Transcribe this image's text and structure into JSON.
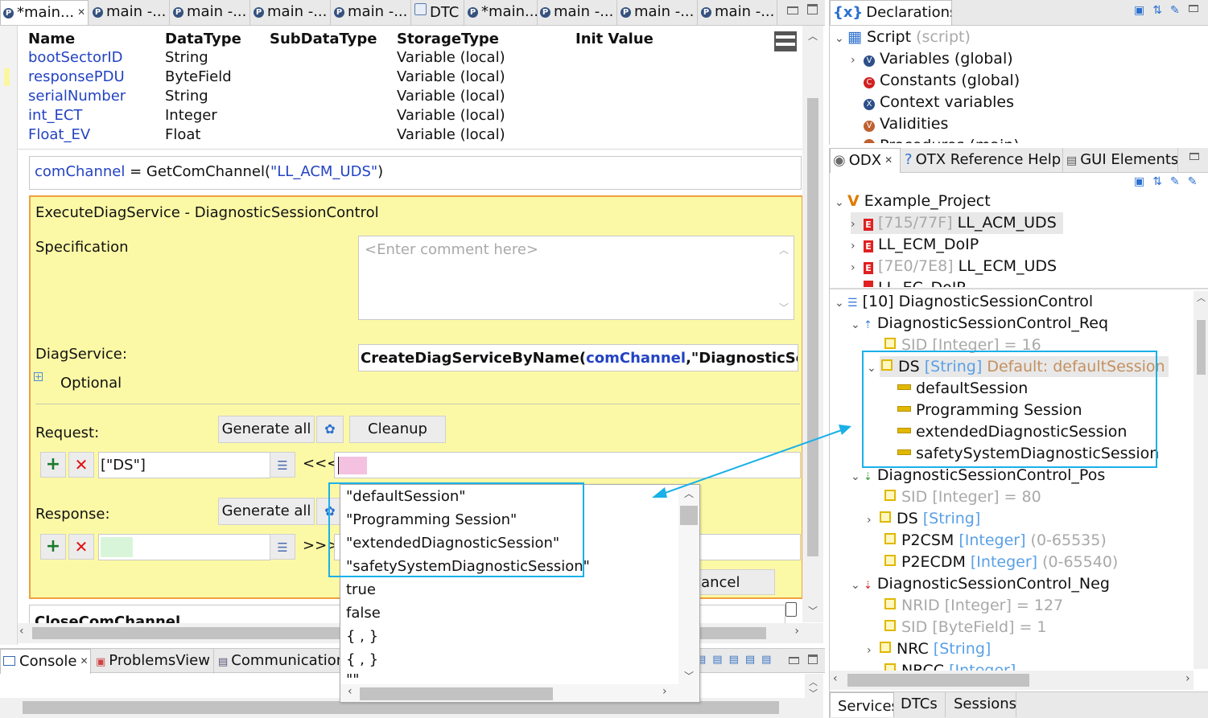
{
  "editor_tabs": [
    {
      "label": "*main...",
      "active": true
    },
    {
      "label": "main -..."
    },
    {
      "label": "main -..."
    },
    {
      "label": "main -..."
    },
    {
      "label": "main -..."
    },
    {
      "label": "DTC"
    },
    {
      "label": "*main..."
    },
    {
      "label": "main -..."
    },
    {
      "label": "main -..."
    },
    {
      "label": "main -..."
    }
  ],
  "variables": {
    "headers": [
      "Name",
      "DataType",
      "SubDataType",
      "StorageType",
      "Init Value"
    ],
    "rows": [
      {
        "name": "bootSectorID",
        "type": "String",
        "sub": "",
        "storage": "Variable (local)",
        "init": ""
      },
      {
        "name": "responsePDU",
        "type": "ByteField",
        "sub": "",
        "storage": "Variable (local)",
        "init": ""
      },
      {
        "name": "serialNumber",
        "type": "String",
        "sub": "",
        "storage": "Variable (local)",
        "init": ""
      },
      {
        "name": "int_ECT",
        "type": "Integer",
        "sub": "",
        "storage": "Variable (local)",
        "init": ""
      },
      {
        "name": "Float_EV",
        "type": "Float",
        "sub": "",
        "storage": "Variable (local)",
        "init": ""
      }
    ]
  },
  "statement": {
    "var": "comChannel",
    "eq": " = GetComChannel(",
    "arg": "\"LL_ACM_UDS\"",
    "close": ")"
  },
  "node": {
    "title": "ExecuteDiagService  -  DiagnosticSessionControl",
    "spec_label": "Specification",
    "comment_placeholder": "<Enter comment here>",
    "diag_label": "DiagService:",
    "diag_fn": "CreateDiagServiceByName",
    "diag_paren": "(",
    "diag_arg1": "comChannel",
    "diag_rest": ",\"DiagnosticSessionCont",
    "optional": "Optional",
    "request_label": "Request:",
    "response_label": "Response:",
    "generate_all": "Generate all",
    "cleanup": "Cleanup",
    "cancel": "Cancel",
    "req_param": "[\"DS\"]",
    "req_arrow": "<<<",
    "resp_arrow": ">>>",
    "next_statement": "CloseComChannel"
  },
  "popup": {
    "items": [
      "\"defaultSession\"",
      "\"Programming Session\"",
      "\"extendedDiagnosticSession\"",
      "\"safetySystemDiagnosticSession\"",
      "true",
      "false",
      "{  ,  }",
      "{  ,  }",
      "\"\""
    ]
  },
  "console_tabs": [
    "Console",
    "ProblemsView",
    "Communication"
  ],
  "declarations": {
    "tab": "Declarations",
    "root": "Script",
    "root_suffix": "(script)",
    "items": [
      {
        "label": "Variables (global)",
        "icon": "V",
        "color": "#2d4f8a"
      },
      {
        "label": "Constants (global)",
        "icon": "C",
        "color": "#d02020"
      },
      {
        "label": "Context variables",
        "icon": "X",
        "color": "#2d4f8a"
      },
      {
        "label": "Validities",
        "icon": "V",
        "color": "#c06030"
      }
    ],
    "cut_item": "Procedures (main)"
  },
  "odx": {
    "tabs": [
      "ODX",
      "OTX Reference Help",
      "GUI Elements"
    ],
    "project": "Example_Project",
    "ecus": [
      {
        "id": "[715/77F]",
        "name": "LL_ACM_UDS"
      },
      {
        "id": "",
        "name": "LL_ECM_DoIP"
      },
      {
        "id": "[7E0/7E8]",
        "name": "LL_ECM_UDS"
      },
      {
        "id": "",
        "name": "LL_EC_DoIP"
      }
    ],
    "service": "[10] DiagnosticSessionControl",
    "req": "DiagnosticSessionControl_Req",
    "req_sid": "SID [Integer] = 16",
    "ds": "DS",
    "ds_type": "[String]",
    "ds_default": "Default: defaultSession",
    "ds_values": [
      "defaultSession",
      "Programming Session",
      "extendedDiagnosticSession",
      "safetySystemDiagnosticSession"
    ],
    "pos": "DiagnosticSessionControl_Pos",
    "pos_sid": "SID [Integer] = 80",
    "pos_ds": "DS",
    "pos_ds_type": "[String]",
    "p2csm": "P2CSM",
    "p2csm_type": "[Integer]",
    "p2csm_range": "(0-65535)",
    "p2ecdm": "P2ECDM",
    "p2ecdm_type": "[Integer]",
    "p2ecdm_range": "(0-65540)",
    "neg": "DiagnosticSessionControl_Neg",
    "nrid": "NRID [Integer] = 127",
    "neg_sid": "SID [ByteField] = 1",
    "nrc": "NRC",
    "nrc_type": "[String]",
    "nrcc": "NRCC",
    "nrcc_type": "[Integer]",
    "bottom_tabs": [
      "Services",
      "DTCs",
      "Sessions"
    ]
  },
  "colors": {
    "accent_highlight": "#1ab0e8",
    "node_bg": "#fcf9a6",
    "node_border": "#f0a040"
  }
}
